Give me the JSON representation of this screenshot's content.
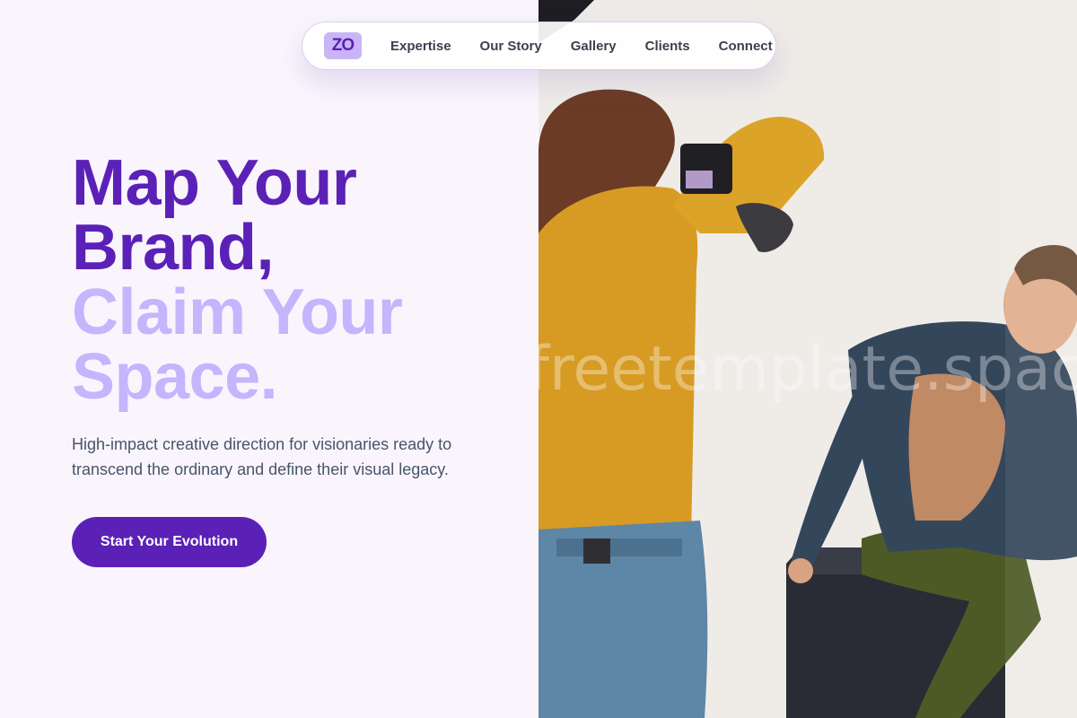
{
  "nav": {
    "logo_text": "ZO",
    "links": [
      {
        "label": "Expertise"
      },
      {
        "label": "Our Story"
      },
      {
        "label": "Gallery"
      },
      {
        "label": "Clients"
      },
      {
        "label": "Connect"
      }
    ]
  },
  "hero": {
    "headline_lines_dark": [
      "Map Your",
      "Brand,"
    ],
    "headline_lines_light": [
      "Claim Your",
      "Space."
    ],
    "lead": "High-impact creative direction for visionaries ready to transcend the ordinary and define their visual legacy.",
    "cta_label": "Start Your Evolution"
  },
  "photo": {
    "subject": "photographer in yellow sweater shooting a model in denim jacket seated on a black box",
    "watermark": "freetemplate.space"
  },
  "colors": {
    "accent": "#5b21b6",
    "accent_light": "#c4b5fd",
    "logo_bg": "#c9b5f6",
    "page_bg": "#faf5fd",
    "body_text": "#475569"
  }
}
